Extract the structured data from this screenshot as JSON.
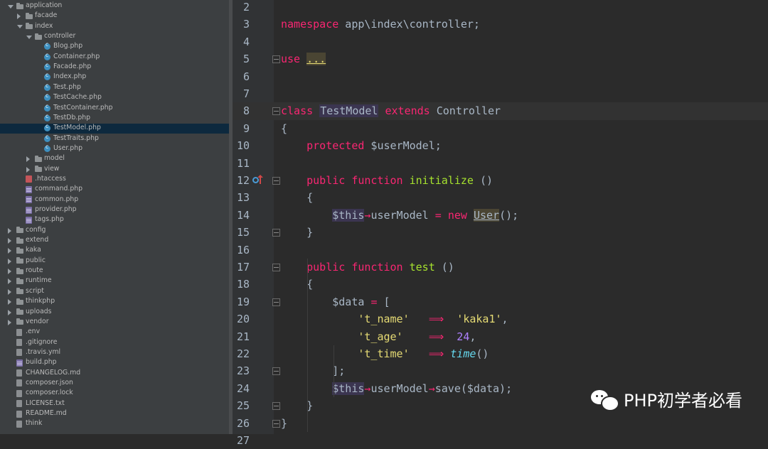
{
  "tree": [
    {
      "label": "application",
      "depth": 0,
      "type": "folder",
      "state": "open"
    },
    {
      "label": "facade",
      "depth": 1,
      "type": "folder",
      "state": "closed"
    },
    {
      "label": "index",
      "depth": 1,
      "type": "folder",
      "state": "open"
    },
    {
      "label": "controller",
      "depth": 2,
      "type": "folder",
      "state": "open"
    },
    {
      "label": "Blog.php",
      "depth": 3,
      "type": "class"
    },
    {
      "label": "Container.php",
      "depth": 3,
      "type": "class"
    },
    {
      "label": "Facade.php",
      "depth": 3,
      "type": "class"
    },
    {
      "label": "Index.php",
      "depth": 3,
      "type": "class"
    },
    {
      "label": "Test.php",
      "depth": 3,
      "type": "class"
    },
    {
      "label": "TestCache.php",
      "depth": 3,
      "type": "class"
    },
    {
      "label": "TestContainer.php",
      "depth": 3,
      "type": "class"
    },
    {
      "label": "TestDb.php",
      "depth": 3,
      "type": "class"
    },
    {
      "label": "TestModel.php",
      "depth": 3,
      "type": "class",
      "selected": true
    },
    {
      "label": "TestTraits.php",
      "depth": 3,
      "type": "class"
    },
    {
      "label": "User.php",
      "depth": 3,
      "type": "class"
    },
    {
      "label": "model",
      "depth": 2,
      "type": "folder",
      "state": "closed"
    },
    {
      "label": "view",
      "depth": 2,
      "type": "folder",
      "state": "closed"
    },
    {
      "label": ".htaccess",
      "depth": 1,
      "type": "htaccess"
    },
    {
      "label": "command.php",
      "depth": 1,
      "type": "php"
    },
    {
      "label": "common.php",
      "depth": 1,
      "type": "php"
    },
    {
      "label": "provider.php",
      "depth": 1,
      "type": "php"
    },
    {
      "label": "tags.php",
      "depth": 1,
      "type": "php"
    },
    {
      "label": "config",
      "depth": 0,
      "type": "folder",
      "state": "closed"
    },
    {
      "label": "extend",
      "depth": 0,
      "type": "folder",
      "state": "closed"
    },
    {
      "label": "kaka",
      "depth": 0,
      "type": "folder",
      "state": "closed"
    },
    {
      "label": "public",
      "depth": 0,
      "type": "folder",
      "state": "closed"
    },
    {
      "label": "route",
      "depth": 0,
      "type": "folder",
      "state": "closed"
    },
    {
      "label": "runtime",
      "depth": 0,
      "type": "folder",
      "state": "closed"
    },
    {
      "label": "script",
      "depth": 0,
      "type": "folder",
      "state": "closed"
    },
    {
      "label": "thinkphp",
      "depth": 0,
      "type": "folder",
      "state": "closed"
    },
    {
      "label": "uploads",
      "depth": 0,
      "type": "folder",
      "state": "closed"
    },
    {
      "label": "vendor",
      "depth": 0,
      "type": "folder",
      "state": "closed"
    },
    {
      "label": ".env",
      "depth": 0,
      "type": "text"
    },
    {
      "label": ".gitignore",
      "depth": 0,
      "type": "text"
    },
    {
      "label": ".travis.yml",
      "depth": 0,
      "type": "text"
    },
    {
      "label": "build.php",
      "depth": 0,
      "type": "php"
    },
    {
      "label": "CHANGELOG.md",
      "depth": 0,
      "type": "text"
    },
    {
      "label": "composer.json",
      "depth": 0,
      "type": "text"
    },
    {
      "label": "composer.lock",
      "depth": 0,
      "type": "text"
    },
    {
      "label": "LICENSE.txt",
      "depth": 0,
      "type": "text"
    },
    {
      "label": "README.md",
      "depth": 0,
      "type": "text"
    },
    {
      "label": "think",
      "depth": 0,
      "type": "text"
    }
  ],
  "editor": {
    "lines": [
      {
        "n": "2",
        "tokens": []
      },
      {
        "n": "3",
        "tokens": [
          {
            "t": "namespace",
            "c": "kw"
          },
          {
            "t": " app\\index\\controller;",
            "c": ""
          }
        ]
      },
      {
        "n": "4",
        "tokens": []
      },
      {
        "n": "5",
        "fold": "box",
        "tokens": [
          {
            "t": "use",
            "c": "kw"
          },
          {
            "t": " ",
            "c": ""
          },
          {
            "t": "...",
            "c": "fold-box"
          }
        ]
      },
      {
        "n": "6",
        "tokens": []
      },
      {
        "n": "7",
        "tokens": []
      },
      {
        "n": "8",
        "fold": "box",
        "current": true,
        "tokens": [
          {
            "t": "class",
            "c": "kw"
          },
          {
            "t": " ",
            "c": ""
          },
          {
            "t": "TestModel",
            "c": "cls-n"
          },
          {
            "t": " ",
            "c": ""
          },
          {
            "t": "extends",
            "c": "kw"
          },
          {
            "t": " Controller",
            "c": ""
          }
        ]
      },
      {
        "n": "9",
        "tokens": [
          {
            "t": "{",
            "c": ""
          }
        ]
      },
      {
        "n": "10",
        "tokens": [
          {
            "t": "    ",
            "c": ""
          },
          {
            "t": "protected",
            "c": "kw"
          },
          {
            "t": " $userModel;",
            "c": ""
          }
        ]
      },
      {
        "n": "11",
        "tokens": []
      },
      {
        "n": "12",
        "fold": "box",
        "override": true,
        "tokens": [
          {
            "t": "    ",
            "c": ""
          },
          {
            "t": "public",
            "c": "kw"
          },
          {
            "t": " ",
            "c": ""
          },
          {
            "t": "function",
            "c": "kw"
          },
          {
            "t": " ",
            "c": ""
          },
          {
            "t": "initialize",
            "c": "fn"
          },
          {
            "t": " ()",
            "c": ""
          }
        ]
      },
      {
        "n": "13",
        "tokens": [
          {
            "t": "    {",
            "c": ""
          }
        ]
      },
      {
        "n": "14",
        "tokens": [
          {
            "t": "        ",
            "c": ""
          },
          {
            "t": "$this",
            "c": "hl"
          },
          {
            "t": "→",
            "c": "kw"
          },
          {
            "t": "userModel ",
            "c": ""
          },
          {
            "t": "=",
            "c": "kw"
          },
          {
            "t": " ",
            "c": ""
          },
          {
            "t": "new",
            "c": "kw"
          },
          {
            "t": " ",
            "c": ""
          },
          {
            "t": "User",
            "c": "user-u"
          },
          {
            "t": "();",
            "c": ""
          }
        ]
      },
      {
        "n": "15",
        "fold": "end",
        "tokens": [
          {
            "t": "    }",
            "c": ""
          }
        ]
      },
      {
        "n": "16",
        "tokens": []
      },
      {
        "n": "17",
        "fold": "box",
        "tokens": [
          {
            "t": "    ",
            "c": ""
          },
          {
            "t": "public",
            "c": "kw"
          },
          {
            "t": " ",
            "c": ""
          },
          {
            "t": "function",
            "c": "kw"
          },
          {
            "t": " ",
            "c": ""
          },
          {
            "t": "test",
            "c": "fn"
          },
          {
            "t": " ()",
            "c": ""
          }
        ]
      },
      {
        "n": "18",
        "tokens": [
          {
            "t": "    {",
            "c": ""
          }
        ]
      },
      {
        "n": "19",
        "fold": "box",
        "tokens": [
          {
            "t": "        $data ",
            "c": ""
          },
          {
            "t": "=",
            "c": "kw"
          },
          {
            "t": " [",
            "c": ""
          }
        ]
      },
      {
        "n": "20",
        "tokens": [
          {
            "t": "            ",
            "c": ""
          },
          {
            "t": "'t_name'",
            "c": "str"
          },
          {
            "t": "   ",
            "c": ""
          },
          {
            "t": "⟹",
            "c": "kw"
          },
          {
            "t": "  ",
            "c": ""
          },
          {
            "t": "'kaka1'",
            "c": "str"
          },
          {
            "t": ",",
            "c": ""
          }
        ]
      },
      {
        "n": "21",
        "tokens": [
          {
            "t": "            ",
            "c": ""
          },
          {
            "t": "'t_age'",
            "c": "str"
          },
          {
            "t": "    ",
            "c": ""
          },
          {
            "t": "⟹",
            "c": "kw"
          },
          {
            "t": "  ",
            "c": ""
          },
          {
            "t": "24",
            "c": "num"
          },
          {
            "t": ",",
            "c": ""
          }
        ]
      },
      {
        "n": "22",
        "tokens": [
          {
            "t": "            ",
            "c": ""
          },
          {
            "t": "'t_time'",
            "c": "str"
          },
          {
            "t": "   ",
            "c": ""
          },
          {
            "t": "⟹",
            "c": "kw"
          },
          {
            "t": " ",
            "c": ""
          },
          {
            "t": "time",
            "c": "it"
          },
          {
            "t": "()",
            "c": ""
          }
        ]
      },
      {
        "n": "23",
        "fold": "end",
        "tokens": [
          {
            "t": "        ];",
            "c": ""
          }
        ]
      },
      {
        "n": "24",
        "tokens": [
          {
            "t": "        ",
            "c": ""
          },
          {
            "t": "$this",
            "c": "hl"
          },
          {
            "t": "→",
            "c": "kw"
          },
          {
            "t": "userModel",
            "c": ""
          },
          {
            "t": "→",
            "c": "kw"
          },
          {
            "t": "save($data);",
            "c": ""
          }
        ]
      },
      {
        "n": "25",
        "fold": "end",
        "tokens": [
          {
            "t": "    }",
            "c": ""
          }
        ]
      },
      {
        "n": "26",
        "fold": "end",
        "tokens": [
          {
            "t": "}",
            "c": ""
          }
        ]
      },
      {
        "n": "27",
        "tokens": []
      }
    ]
  },
  "watermark": {
    "text": "PHP初学者必看",
    "icon": "wechat-icon"
  },
  "colors": {
    "keyword": "#f92672",
    "function": "#a6e22e",
    "string": "#e6db74",
    "number": "#ae81ff",
    "background": "#2b2b2b",
    "tree_background": "#3c3f41",
    "selection": "#0d293e"
  }
}
